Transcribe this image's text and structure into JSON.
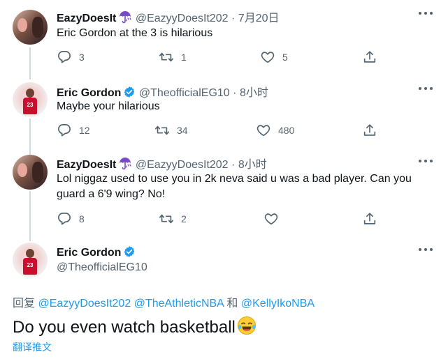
{
  "tweets": [
    {
      "name": "EazyDoesIt",
      "has_umbrella": true,
      "handle": "@EazyyDoesIt202",
      "dot": "·",
      "time": "7月20日",
      "text": "Eric Gordon at the 3 is hilarious",
      "reply_count": "3",
      "retweet_count": "1",
      "like_count": "5"
    },
    {
      "name": "Eric Gordon",
      "verified": true,
      "handle": "@TheofficialEG10",
      "dot": "·",
      "time": "8小时",
      "text": "Maybe your hilarious",
      "reply_count": "12",
      "retweet_count": "34",
      "like_count": "480"
    },
    {
      "name": "EazyDoesIt",
      "has_umbrella": true,
      "handle": "@EazyyDoesIt202",
      "dot": "·",
      "time": "8小时",
      "text_line1": "Lol niggaz used to use you in 2k neva said u was a bad player. Can you",
      "text_line2": "guard a 6'9 wing? No!",
      "reply_count": "8",
      "retweet_count": "2",
      "like_count": ""
    }
  ],
  "main_tweet": {
    "name": "Eric Gordon",
    "verified": true,
    "handle": "@TheofficialEG10",
    "reply_prefix": "回复",
    "reply_users": [
      "@EazyyDoesIt202",
      "@TheAthleticNBA",
      "@KellyIkoNBA"
    ],
    "reply_and": "和",
    "text": "Do you even watch basketball",
    "emoji": "face-with-tears-of-joy",
    "translate_label": "翻译推文"
  },
  "colors": {
    "text": "#0f1419",
    "secondary": "#536471",
    "link": "#1d9bf0",
    "verified": "#1d9bf0",
    "umbrella": "#794bc4"
  }
}
